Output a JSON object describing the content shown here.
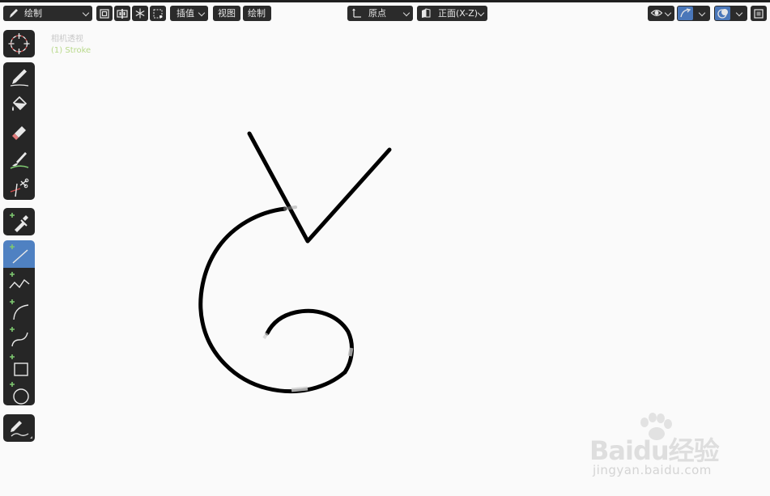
{
  "header": {
    "mode_label": "绘制",
    "interpolate_label": "插值",
    "view_menu": "视图",
    "draw_menu": "绘制",
    "origin_label": "原点",
    "orientation_label": "正面(X-Z)"
  },
  "viewport": {
    "camera_label": "相机透视",
    "object_label": "(1) Stroke"
  },
  "toolbar": {
    "tools": [
      {
        "name": "cursor",
        "icon": "cursor-icon",
        "active": false
      },
      {
        "name": "draw",
        "icon": "pencil-icon",
        "active": false
      },
      {
        "name": "fill",
        "icon": "fill-bucket-icon",
        "active": false
      },
      {
        "name": "erase",
        "icon": "eraser-icon",
        "active": false
      },
      {
        "name": "tint",
        "icon": "tint-brush-icon",
        "active": false
      },
      {
        "name": "cutter",
        "icon": "cutter-icon",
        "active": false
      },
      {
        "name": "eyedropper",
        "icon": "eyedropper-icon",
        "active": false
      },
      {
        "name": "line",
        "icon": "line-icon",
        "active": true
      },
      {
        "name": "polyline",
        "icon": "polyline-icon",
        "active": false
      },
      {
        "name": "arc",
        "icon": "arc-icon",
        "active": false
      },
      {
        "name": "curve",
        "icon": "curve-icon",
        "active": false
      },
      {
        "name": "box",
        "icon": "box-icon",
        "active": false
      },
      {
        "name": "circle",
        "icon": "circle-icon",
        "active": false
      },
      {
        "name": "annotate",
        "icon": "annotate-icon",
        "active": false
      }
    ]
  },
  "watermark": {
    "main": "Baidu经验",
    "sub": "jingyan.baidu.com"
  },
  "colors": {
    "panel": "#262626",
    "accent": "#4f81c2",
    "canvas": "#fafafa",
    "stroke": "#000000",
    "tool_green": "#7ec870"
  }
}
